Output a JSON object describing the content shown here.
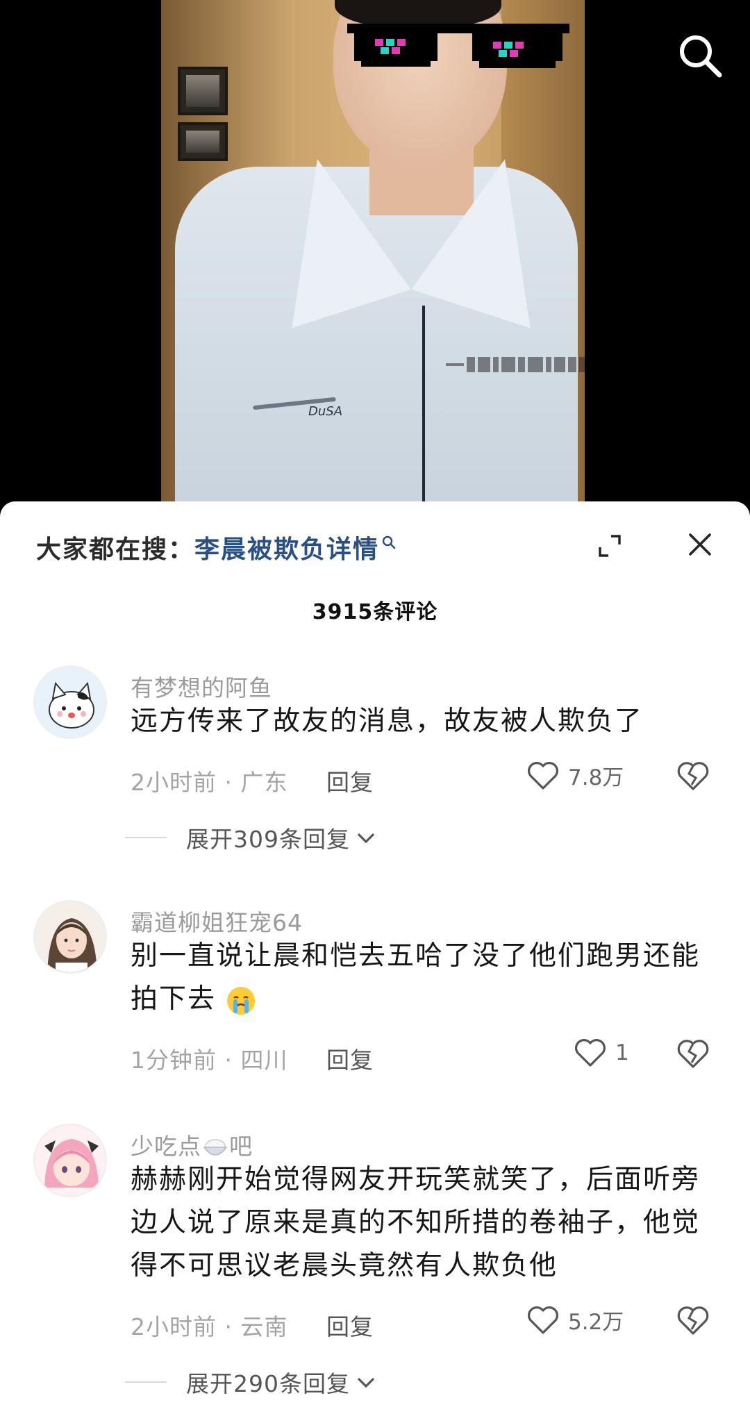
{
  "hot_search": {
    "prefix": "大家都在搜：",
    "term": "李晨被欺负详情"
  },
  "comment_count": "3915条评论",
  "comments": [
    {
      "username": "有梦想的阿鱼",
      "text": "远方传来了故友的消息，故友被人欺负了",
      "time_location": "2小时前 · 广东",
      "reply_label": "回复",
      "likes": "7.8万",
      "expand_replies": "展开309条回复"
    },
    {
      "username": "霸道柳姐狂宠64",
      "text": "别一直说让晨和恺去五哈了没了他们跑男还能拍下去",
      "time_location": "1分钟前 · 四川",
      "reply_label": "回复",
      "likes": "1"
    },
    {
      "username_a": "少吃点",
      "username_b": "吧",
      "text": "赫赫刚开始觉得网友开玩笑就笑了，后面听旁边人说了原来是真的不知所措的卷袖子，他觉得不可思议老晨头竟然有人欺负他",
      "time_location": "2小时前 · 云南",
      "reply_label": "回复",
      "likes": "5.2万",
      "expand_replies": "展开290条回复"
    }
  ],
  "video": {
    "pocket_text": "DuSA"
  }
}
